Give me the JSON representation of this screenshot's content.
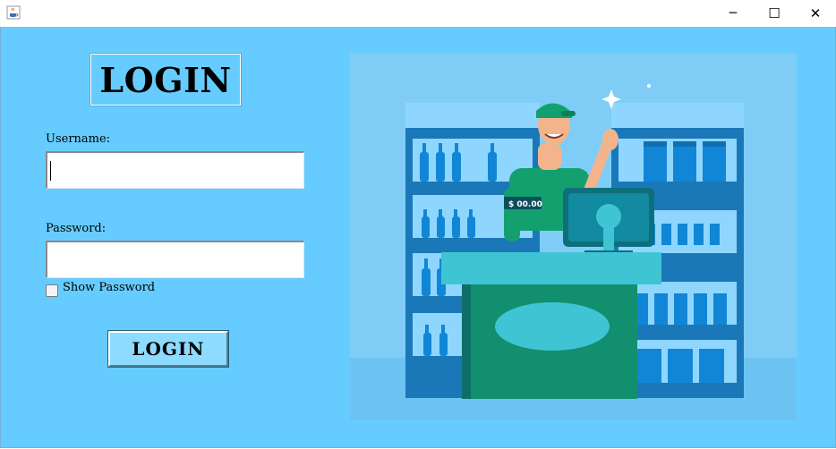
{
  "window": {
    "controls": {
      "minimize": "─",
      "maximize": "☐",
      "close": "✕"
    }
  },
  "form": {
    "title": "LOGIN",
    "username_label": "Username:",
    "username_value": "",
    "password_label": "Password:",
    "password_value": "",
    "show_password_label": "Show Password",
    "show_password_checked": false,
    "login_button": "LOGIN"
  },
  "illustration": {
    "price_tag": "$ 00.00"
  },
  "colors": {
    "background": "#66ccff",
    "illustration_bg": "#7fcdf7",
    "shelf_blue": "#1a78b8",
    "counter_green": "#128f6e",
    "counter_teal": "#3fc4d4",
    "button": "#8ddcff"
  },
  "icons": {
    "app": "java-cup-icon",
    "minimize": "minimize-icon",
    "maximize": "maximize-icon",
    "close": "close-icon"
  }
}
